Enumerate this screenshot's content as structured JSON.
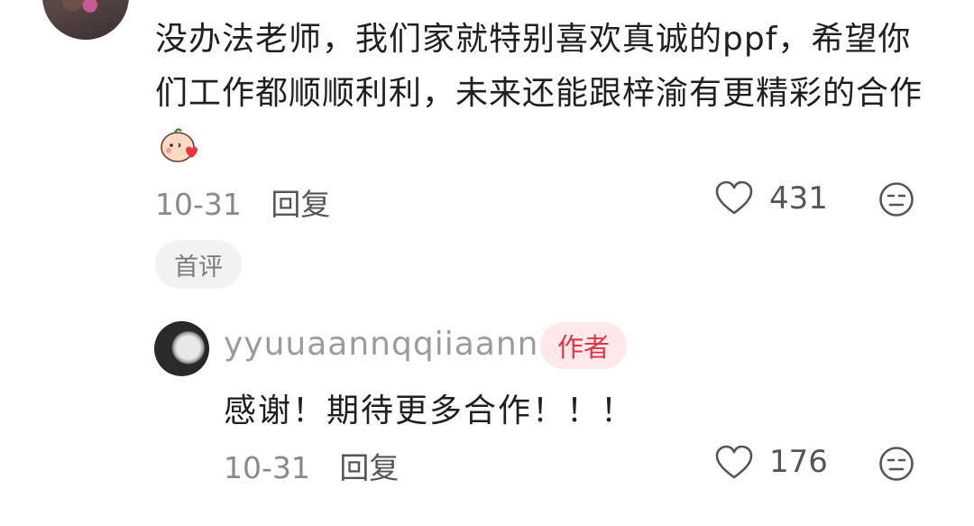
{
  "comment": {
    "text": "没办法老师，我们家就特别喜欢真诚的ppf，希望你们工作都顺顺利利，未来还能跟梓渝有更精彩的合作",
    "emoji": "blush-kiss-emoji",
    "date": "10-31",
    "reply_label": "回复",
    "likes": "431",
    "badge": "首评"
  },
  "reply": {
    "username": "yyuuaannqqiiaann",
    "author_badge": "作者",
    "text": "感谢！期待更多合作！！！",
    "date": "10-31",
    "reply_label": "回复",
    "likes": "176"
  },
  "icons": {
    "like": "heart-outline-icon",
    "dislike": "meh-face-icon"
  },
  "colors": {
    "author_badge_bg": "#fde8ea",
    "author_badge_text": "#e0344b",
    "meta_text": "#8a8a8a"
  }
}
